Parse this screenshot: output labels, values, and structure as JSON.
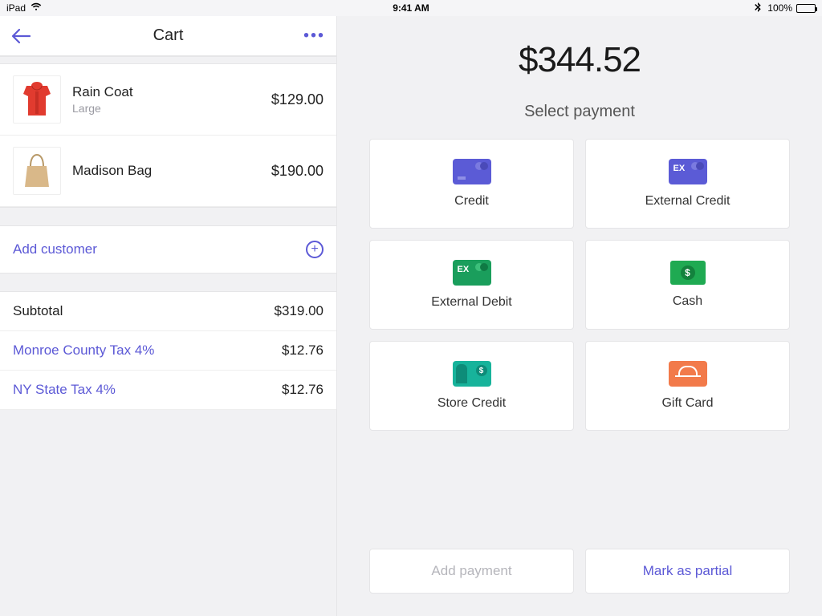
{
  "status": {
    "device": "iPad",
    "time": "9:41 AM",
    "battery_pct": "100%"
  },
  "cart": {
    "title": "Cart",
    "items": [
      {
        "name": "Rain Coat",
        "variant": "Large",
        "price": "$129.00"
      },
      {
        "name": "Madison Bag",
        "variant": "",
        "price": "$190.00"
      }
    ],
    "add_customer_label": "Add customer",
    "subtotal_label": "Subtotal",
    "subtotal_value": "$319.00",
    "taxes": [
      {
        "label": "Monroe County Tax 4%",
        "value": "$12.76"
      },
      {
        "label": "NY State Tax 4%",
        "value": "$12.76"
      }
    ]
  },
  "checkout": {
    "total": "$344.52",
    "select_label": "Select payment",
    "methods": [
      {
        "label": "Credit",
        "icon": "credit"
      },
      {
        "label": "External Credit",
        "icon": "excredit"
      },
      {
        "label": "External Debit",
        "icon": "exdebit"
      },
      {
        "label": "Cash",
        "icon": "cash"
      },
      {
        "label": "Store Credit",
        "icon": "store"
      },
      {
        "label": "Gift Card",
        "icon": "gift"
      }
    ],
    "add_payment_label": "Add payment",
    "mark_partial_label": "Mark as partial"
  }
}
